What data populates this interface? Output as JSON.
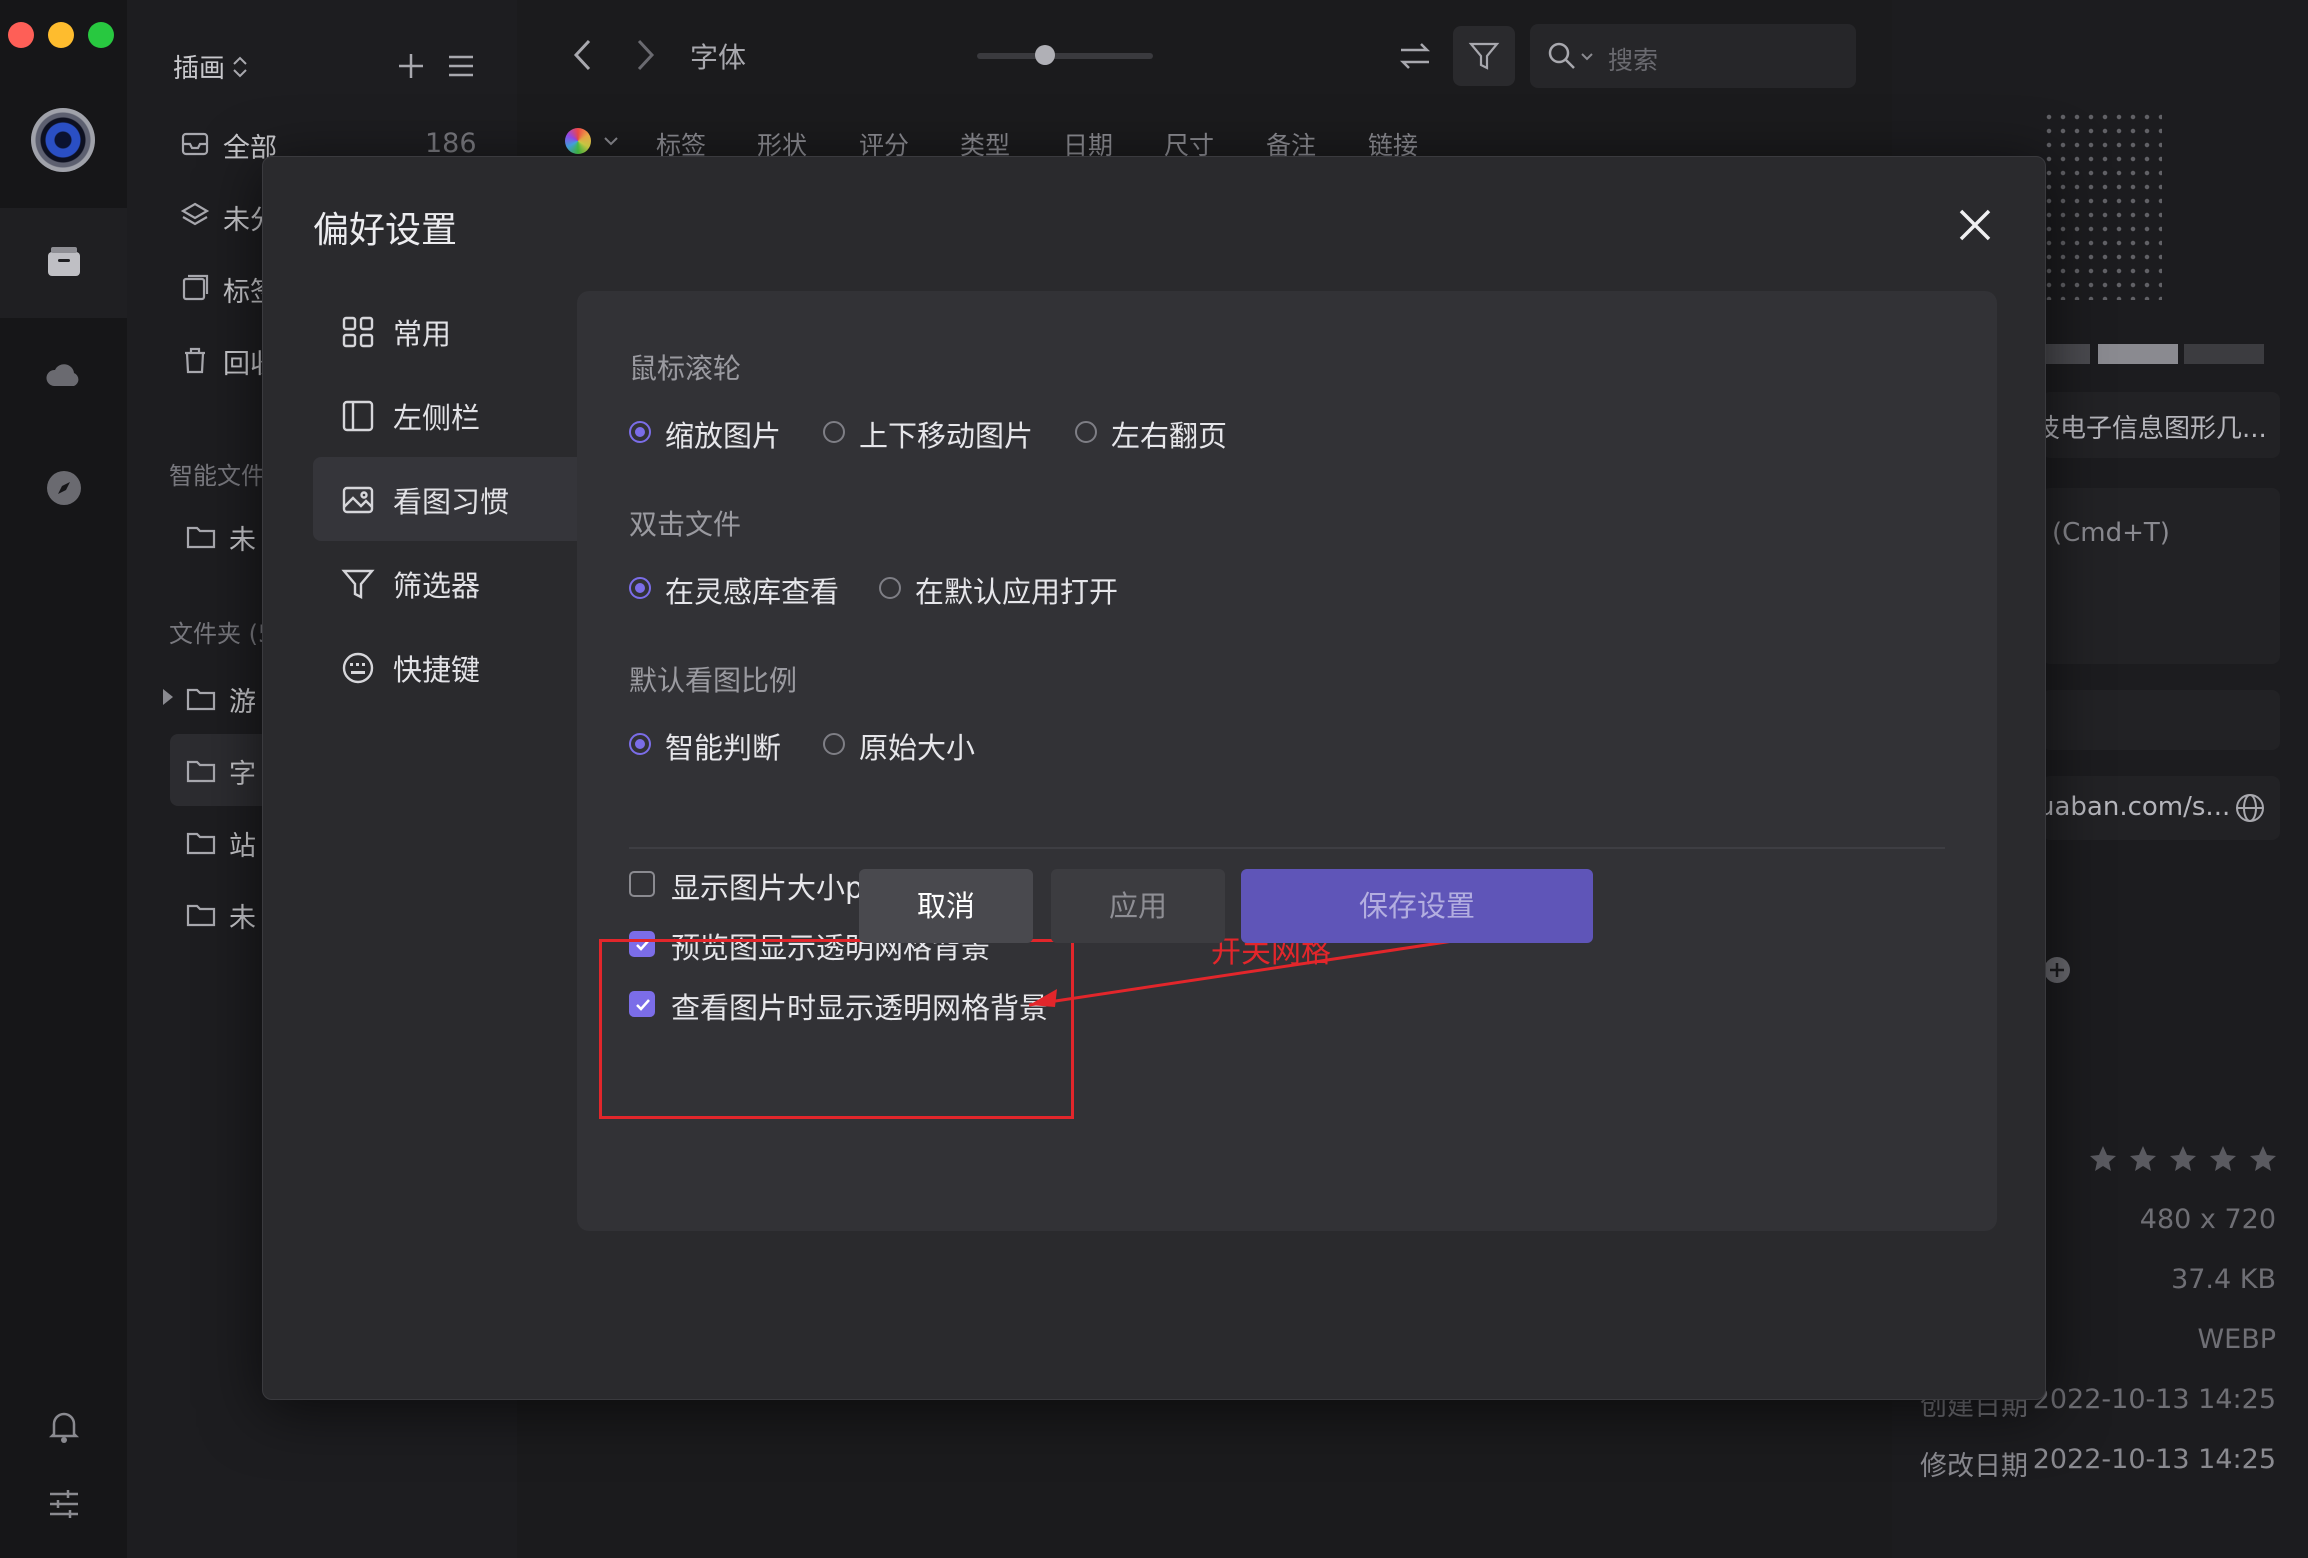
{
  "sidebar": {
    "library_name": "插画",
    "items": [
      {
        "label": "全部",
        "count": "186"
      },
      {
        "label": "未分"
      },
      {
        "label": "标签"
      },
      {
        "label": "回收"
      }
    ],
    "smart_section": "智能文件",
    "smart_items": [
      {
        "label": "未"
      }
    ],
    "folder_section": "文件夹 (5",
    "folders": [
      {
        "label": "游"
      },
      {
        "label": "字"
      },
      {
        "label": "站"
      },
      {
        "label": "未"
      }
    ]
  },
  "topbar": {
    "folder_title": "字体",
    "search_placeholder": "搜索",
    "filters": [
      "标签",
      "形状",
      "评分",
      "类型",
      "日期",
      "尺寸",
      "备注",
      "链接"
    ]
  },
  "info_panel": {
    "title": "技电子信息图形几...",
    "note_hint": "(Cmd+T)",
    "url": "uaban.com/s...",
    "dimensions": "480 x 720",
    "file_size": "37.4 KB",
    "format": "WEBP",
    "created_label": "创建日期",
    "created_value": "2022-10-13 14:25",
    "modified_label": "修改日期",
    "modified_value": "2022-10-13 14:25",
    "rating": 0
  },
  "dialog": {
    "title": "偏好设置",
    "nav": [
      {
        "label": "常用",
        "icon": "grid-icon"
      },
      {
        "label": "左侧栏",
        "icon": "sidebar-icon"
      },
      {
        "label": "看图习惯",
        "icon": "image-icon",
        "active": true
      },
      {
        "label": "筛选器",
        "icon": "filter-icon"
      },
      {
        "label": "快捷键",
        "icon": "keyboard-icon"
      }
    ],
    "mouse_wheel": {
      "title": "鼠标滚轮",
      "options": [
        "缩放图片",
        "上下移动图片",
        "左右翻页"
      ],
      "selected": "缩放图片"
    },
    "double_click": {
      "title": "双击文件",
      "options": [
        "在灵感库查看",
        "在默认应用打开"
      ],
      "selected": "在灵感库查看"
    },
    "default_zoom": {
      "title": "默认看图比例",
      "options": [
        "智能判断",
        "原始大小"
      ],
      "selected": "智能判断"
    },
    "checkboxes": [
      {
        "label": "显示图片大小px单位",
        "checked": false
      },
      {
        "label": "预览图显示透明网格背景",
        "checked": true
      },
      {
        "label": "查看图片时显示透明网格背景",
        "checked": true
      }
    ],
    "annotation": "开关网格",
    "buttons": {
      "cancel": "取消",
      "apply": "应用",
      "save": "保存设置"
    }
  },
  "colors": {
    "accent": "#7b6de8",
    "annotation": "#e2262b",
    "save_button": "#5f55b8"
  }
}
